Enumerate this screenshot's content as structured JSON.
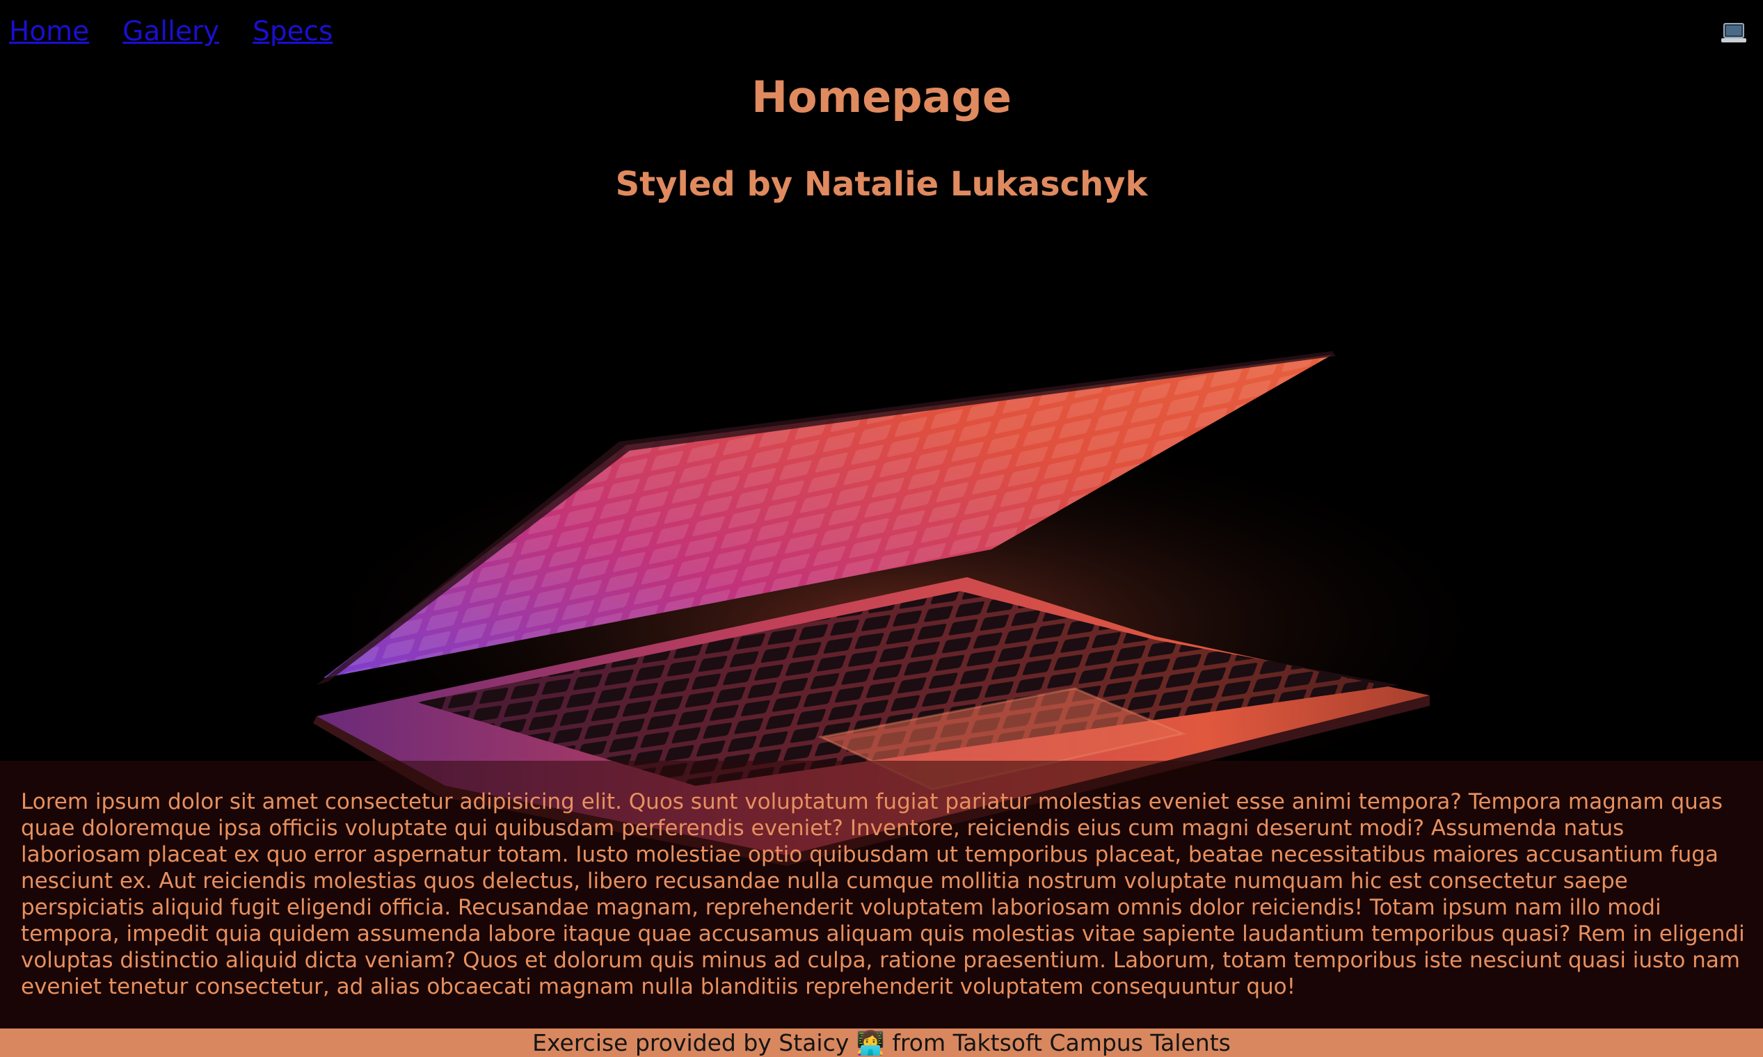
{
  "nav": {
    "items": [
      {
        "label": "Home"
      },
      {
        "label": "Gallery"
      },
      {
        "label": "Specs"
      }
    ],
    "logo_icon": "laptop-icon"
  },
  "header": {
    "title": "Homepage",
    "subtitle": "Styled by Natalie Lukaschyk"
  },
  "hero": {
    "image_icon": "laptop-glow-image"
  },
  "main": {
    "body_text": "Lorem ipsum dolor sit amet consectetur adipisicing elit. Quos sunt voluptatum fugiat pariatur molestias eveniet esse animi tempora? Tempora magnam quas quae doloremque ipsa officiis voluptate qui quibusdam perferendis eveniet? Inventore, reiciendis eius cum magni deserunt modi? Assumenda natus laboriosam placeat ex quo error aspernatur totam. Iusto molestiae optio quibusdam ut temporibus placeat, beatae necessitatibus maiores accusantium fuga nesciunt ex. Aut reiciendis molestias quos delectus, libero recusandae nulla cumque mollitia nostrum voluptate numquam hic est consectetur saepe perspiciatis aliquid fugit eligendi officia. Recusandae magnam, reprehenderit voluptatem laboriosam omnis dolor reiciendis! Totam ipsum nam illo modi tempora, impedit quia quidem assumenda labore itaque quae accusamus aliquam quis molestias vitae sapiente laudantium temporibus quasi? Rem in eligendi voluptas distinctio aliquid dicta veniam? Quos et dolorum quis minus ad culpa, ratione praesentium. Laborum, totam temporibus iste nesciunt quasi iusto nam eveniet tenetur consectetur, ad alias obcaecati magnam nulla blanditiis reprehenderit voluptatem consequuntur quo!"
  },
  "footer": {
    "text": "Exercise provided by Staicy 👩‍💻 from Taktsoft Campus Talents"
  },
  "colors": {
    "accent": "#e08a5f",
    "footer_bg": "#d9875e",
    "link": "#1a0fd0",
    "background": "#000000"
  }
}
